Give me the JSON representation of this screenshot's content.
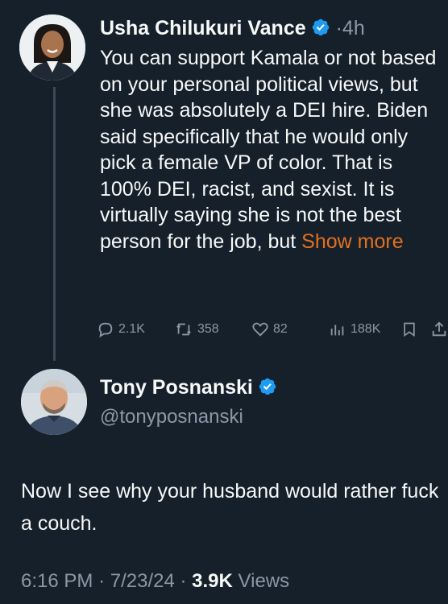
{
  "tweet1": {
    "author_name": "Usha Chilukuri Vance",
    "time_separator": "·",
    "time": "4h",
    "text": "You can support Kamala or not based on your personal political views, but she was absolutely a DEI hire. Biden said specifically that he would only pick a female VP of color. That is 100% DEI, racist, and sexist. It is virtually saying she is not the best person for the job, but ",
    "show_more": "Show more",
    "actions": {
      "replies": "2.1K",
      "reposts": "358",
      "likes": "82",
      "views": "188K"
    }
  },
  "tweet2": {
    "author_name": "Tony Posnanski",
    "handle": "@tonyposnanski",
    "text": "Now I see why your husband  would rather fuck a couch.",
    "time": "6:16 PM",
    "separator1": "·",
    "date": "7/23/24",
    "separator2": "·",
    "views_count": "3.9K",
    "views_label": "Views"
  },
  "colors": {
    "background": "#15202b",
    "text": "#f7f9f9",
    "secondary_text": "#8b98a5",
    "verified_badge": "#1d9bf0",
    "show_more": "#e4701e"
  },
  "icons": {
    "reply": "reply-icon",
    "repost": "repost-icon",
    "like": "heart-icon",
    "views": "views-icon",
    "bookmark": "bookmark-icon",
    "share": "share-icon",
    "verified": "verified-badge-icon"
  }
}
